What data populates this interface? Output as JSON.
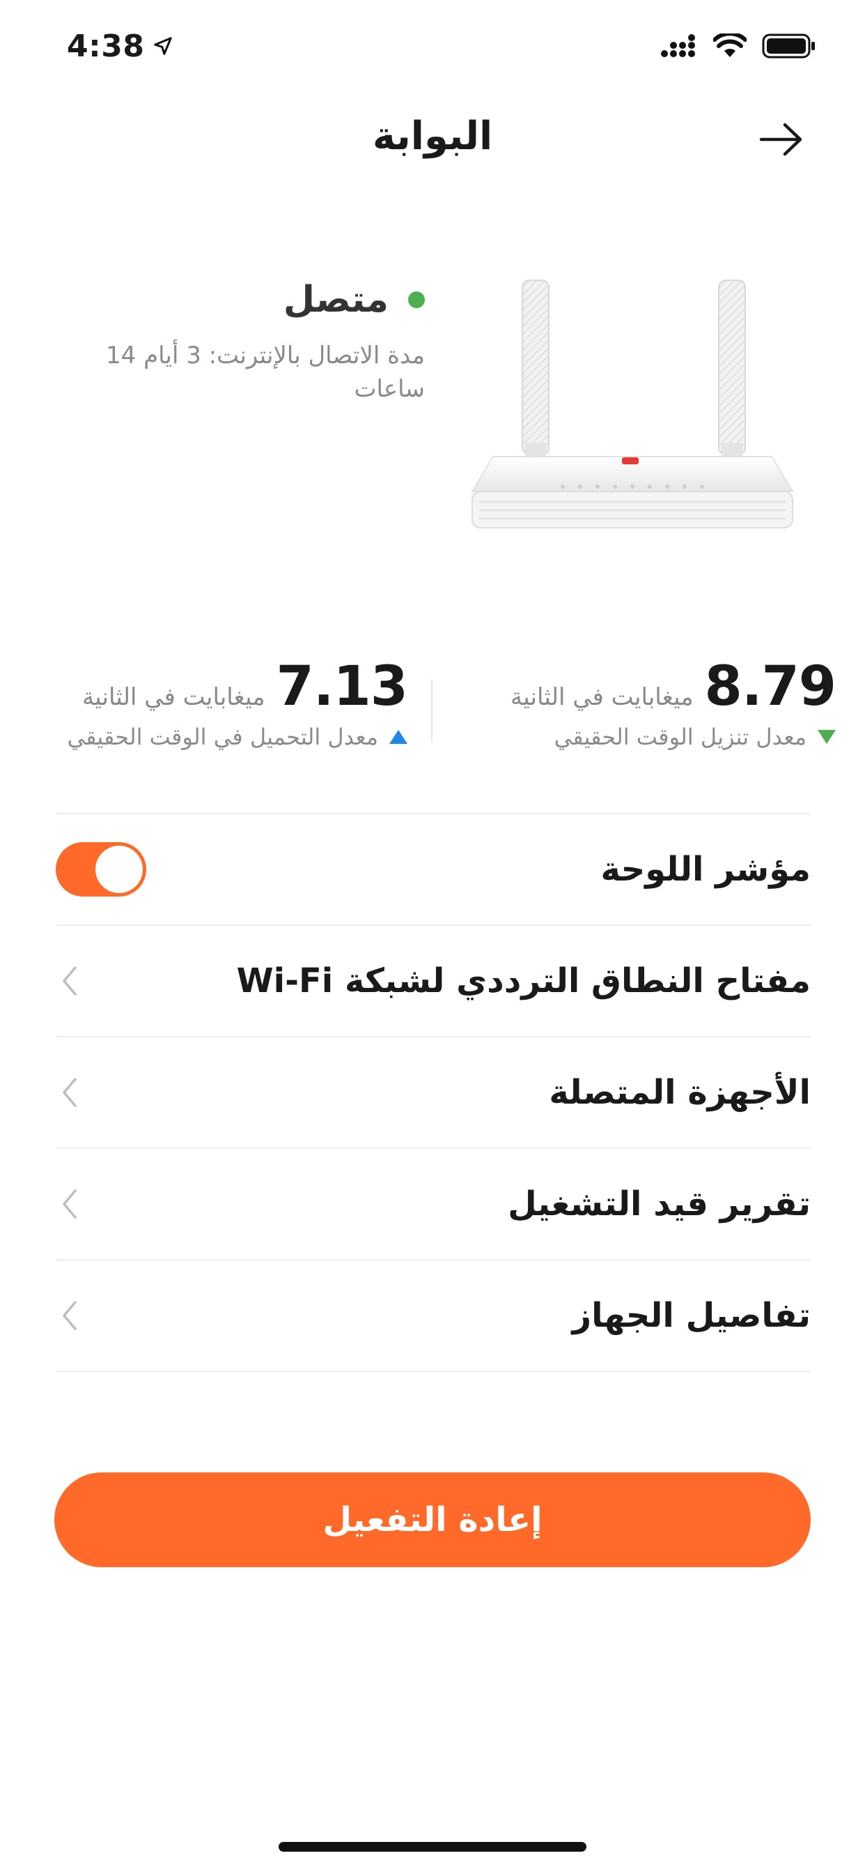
{
  "status_bar": {
    "time": "4:38",
    "icons": [
      "location-arrow-icon",
      "signal-icon",
      "wifi-icon",
      "battery-icon"
    ]
  },
  "nav": {
    "title": "البوابة",
    "back_icon": "arrow-right-icon"
  },
  "device": {
    "status": "متصل",
    "status_color": "#4caf50",
    "uptime_text": "مدة الاتصال بالإنترنت: 3  أيام 14 ساعات"
  },
  "speeds": {
    "download": {
      "value": "8.79",
      "unit": "ميغابايت في الثانية",
      "label": "معدل تنزيل الوقت الحقيقي",
      "icon": "triangle-down-icon",
      "color": "#4caf50"
    },
    "upload": {
      "value": "7.13",
      "unit": "ميغابايت في الثانية",
      "label": "معدل التحميل في الوقت الحقيقي",
      "icon": "triangle-up-icon",
      "color": "#1e88e5"
    }
  },
  "settings": {
    "panel_indicator": {
      "label": "مؤشر اللوحة",
      "enabled": true
    },
    "items": [
      {
        "label": "مفتاح النطاق الترددي لشبكة Wi-Fi"
      },
      {
        "label": "الأجهزة المتصلة"
      },
      {
        "label": "تقرير قيد التشغيل"
      },
      {
        "label": "تفاصيل الجهاز"
      }
    ]
  },
  "actions": {
    "reactivate_label": "إعادة التفعيل"
  },
  "colors": {
    "accent": "#ff6a2a",
    "text_primary": "#1a1a1a",
    "text_secondary": "#8a8a8a"
  }
}
